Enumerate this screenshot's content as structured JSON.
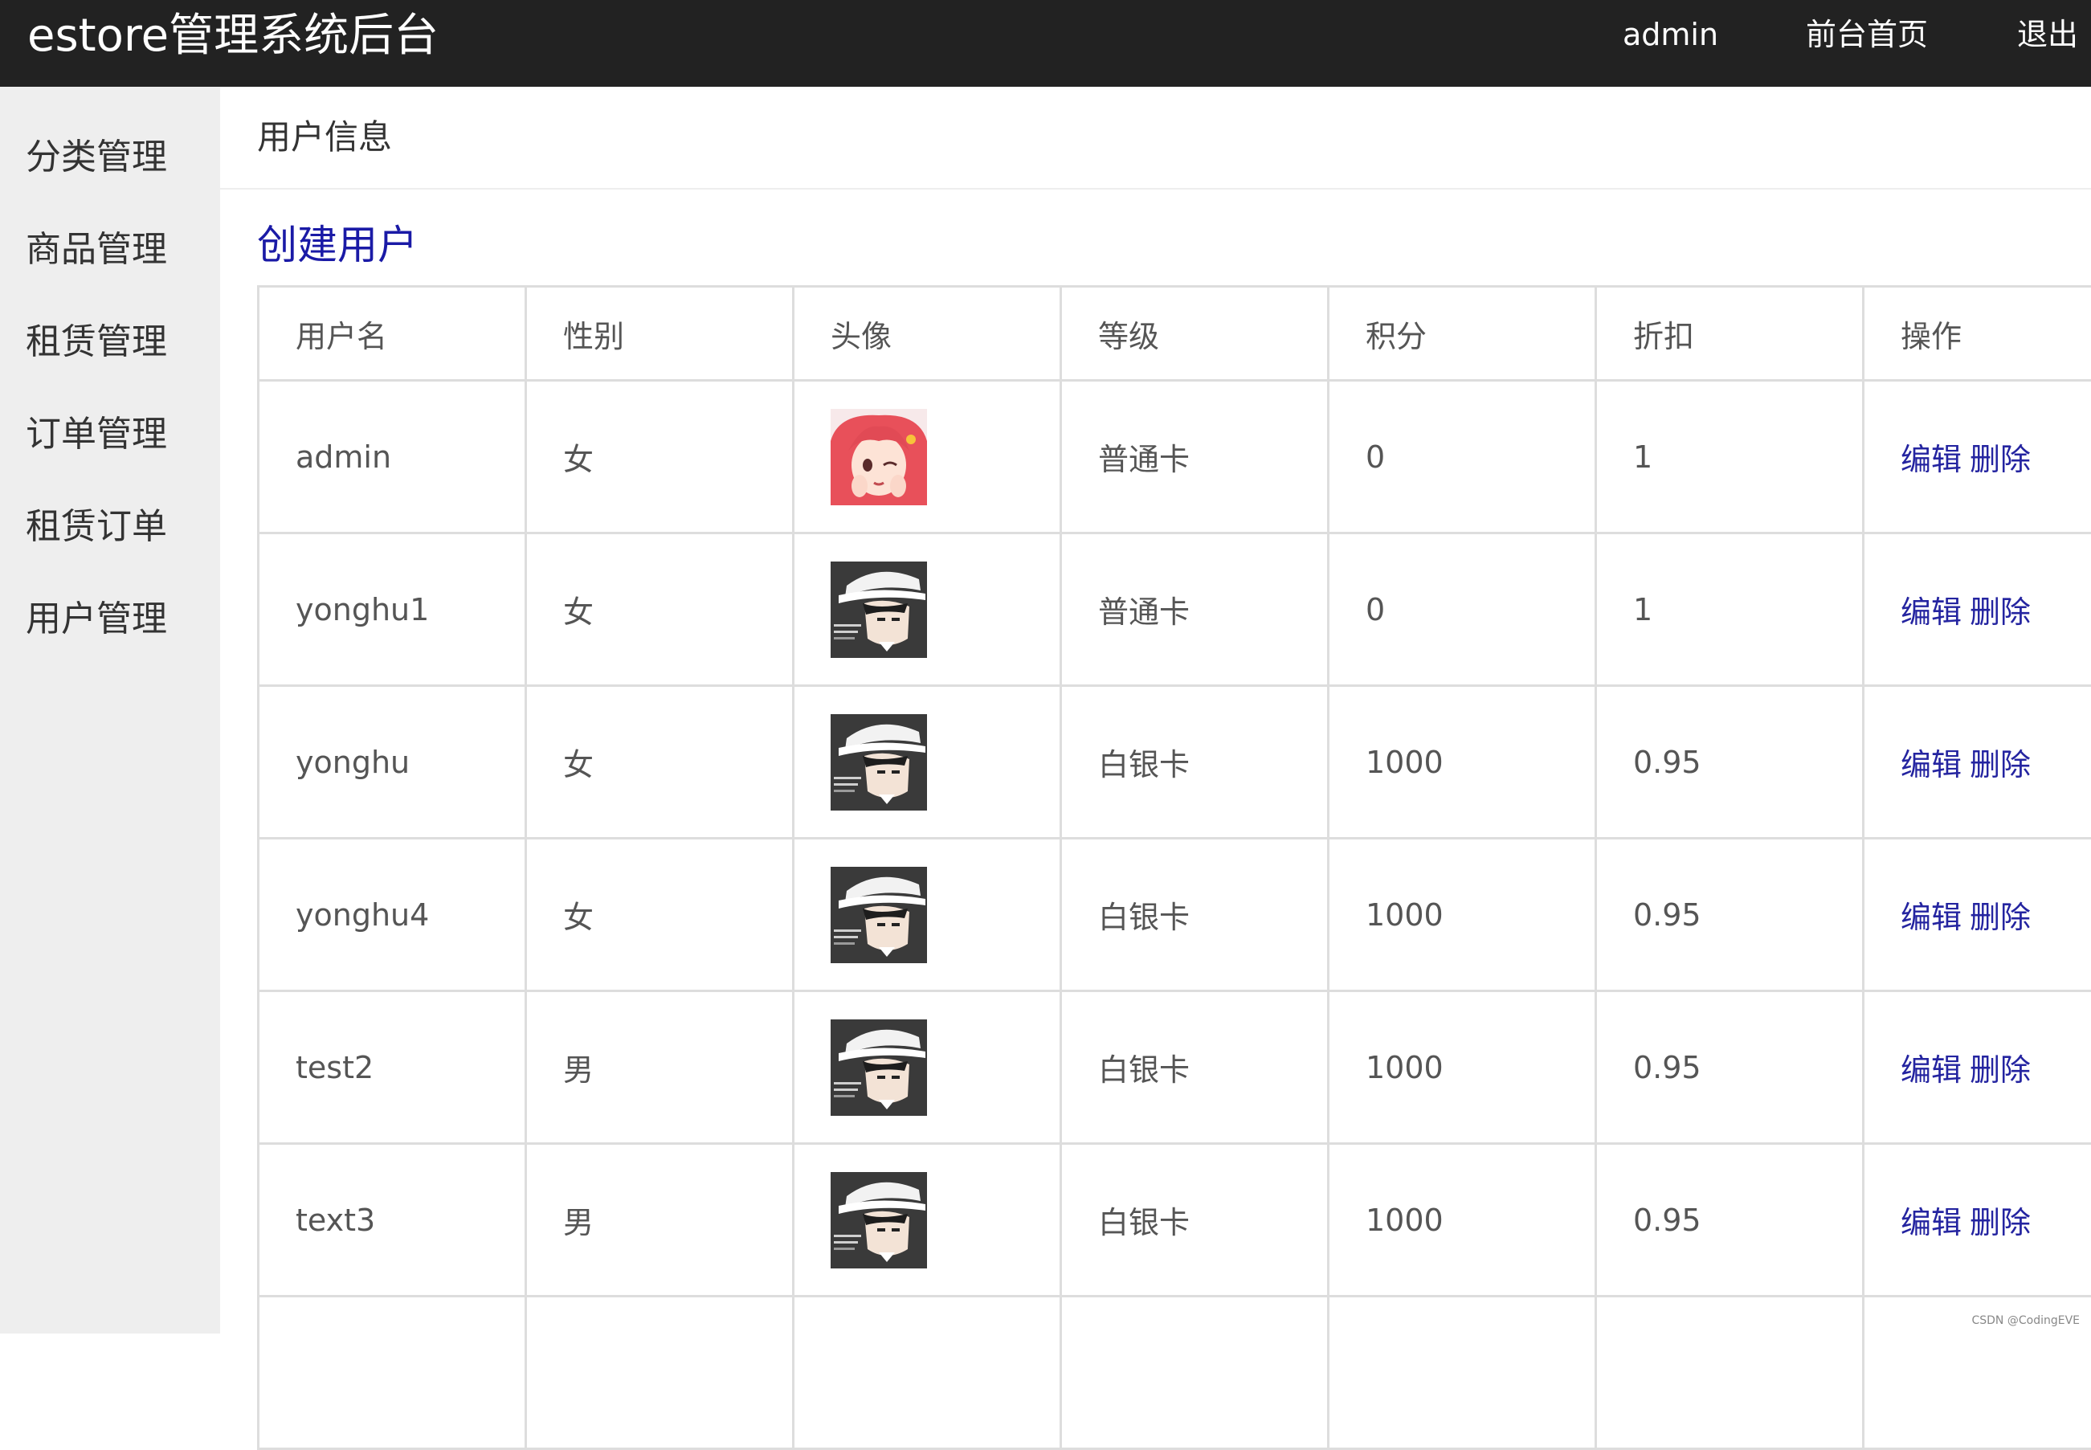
{
  "header": {
    "brand": "estore管理系统后台",
    "nav": {
      "admin": "admin",
      "home": "前台首页",
      "logout": "退出"
    }
  },
  "sidebar": {
    "items": [
      {
        "label": "分类管理"
      },
      {
        "label": "商品管理"
      },
      {
        "label": "租赁管理"
      },
      {
        "label": "订单管理"
      },
      {
        "label": "租赁订单"
      },
      {
        "label": "用户管理"
      }
    ]
  },
  "main": {
    "page_title": "用户信息",
    "create_link": "创建用户",
    "table": {
      "columns": [
        "用户名",
        "性别",
        "头像",
        "等级",
        "积分",
        "折扣",
        "操作"
      ],
      "edit_label": "编辑",
      "delete_label": "删除",
      "rows": [
        {
          "username": "admin",
          "gender": "女",
          "avatar": "anime-girl-avatar",
          "level": "普通卡",
          "points": "0",
          "discount": "1"
        },
        {
          "username": "yonghu1",
          "gender": "女",
          "avatar": "kaito-kid-avatar",
          "level": "普通卡",
          "points": "0",
          "discount": "1"
        },
        {
          "username": "yonghu",
          "gender": "女",
          "avatar": "kaito-kid-avatar",
          "level": "白银卡",
          "points": "1000",
          "discount": "0.95"
        },
        {
          "username": "yonghu4",
          "gender": "女",
          "avatar": "kaito-kid-avatar",
          "level": "白银卡",
          "points": "1000",
          "discount": "0.95"
        },
        {
          "username": "test2",
          "gender": "男",
          "avatar": "kaito-kid-avatar",
          "level": "白银卡",
          "points": "1000",
          "discount": "0.95"
        },
        {
          "username": "text3",
          "gender": "男",
          "avatar": "kaito-kid-avatar",
          "level": "白银卡",
          "points": "1000",
          "discount": "0.95"
        }
      ]
    }
  },
  "watermark": "CSDN @CodingEVE",
  "colors": {
    "topbar": "#222222",
    "sidebar": "#eeeeee",
    "link": "#1a1aa6",
    "table_border": "#dddddd"
  }
}
